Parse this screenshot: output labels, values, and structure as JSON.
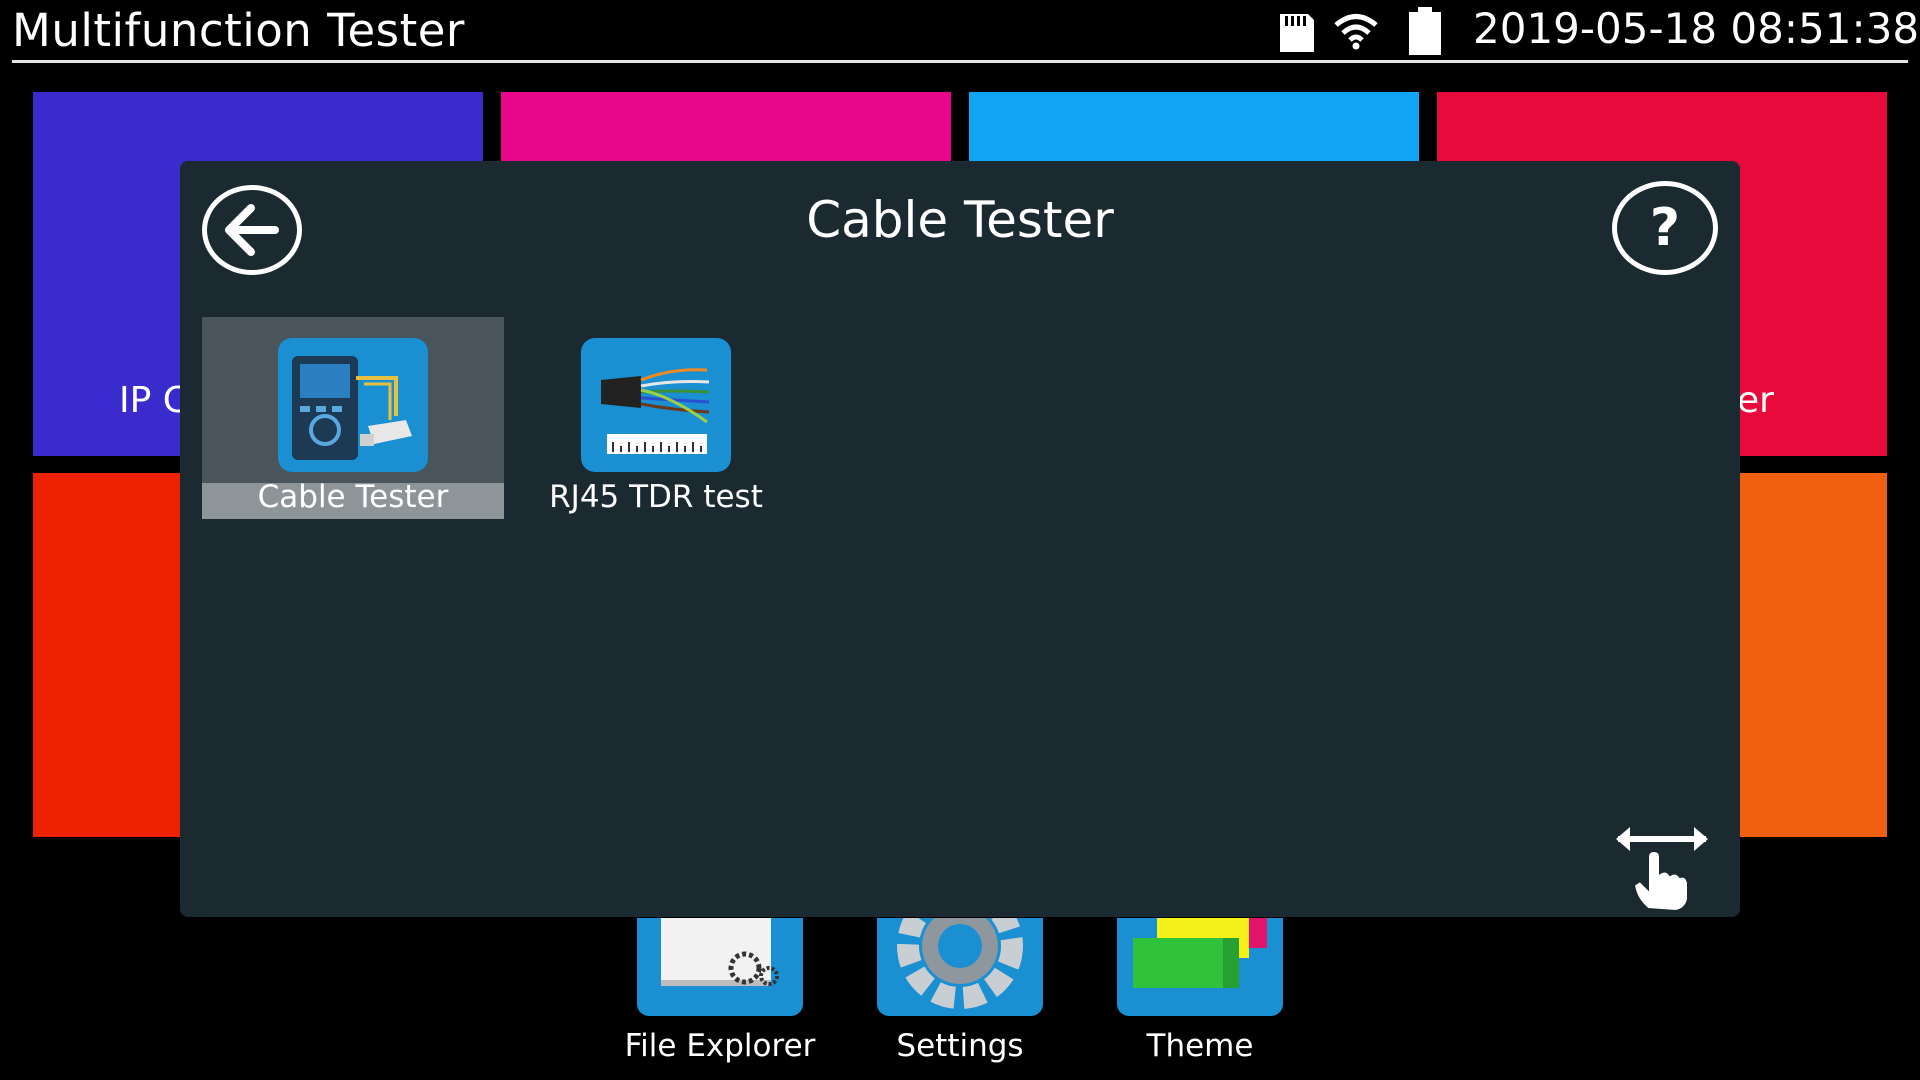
{
  "status_bar": {
    "title": "Multifunction Tester",
    "datetime": "2019-05-18 08:51:38",
    "icons": [
      "sd-card-icon",
      "wifi-icon",
      "battery-icon"
    ]
  },
  "home_tiles": [
    {
      "label": "IP C",
      "color": "#3a2bcc"
    },
    {
      "label": "",
      "color": "#e8078a"
    },
    {
      "label": "",
      "color": "#10a5f5"
    },
    {
      "label": "er",
      "color": "#e80a3a"
    },
    {
      "label": "",
      "color": "#ee2200"
    },
    {
      "label": "",
      "color": "#ee6010"
    }
  ],
  "dock": [
    {
      "label": "File Explorer",
      "icon": "file-explorer-icon"
    },
    {
      "label": "Settings",
      "icon": "settings-gear-icon"
    },
    {
      "label": "Theme",
      "icon": "theme-icon"
    }
  ],
  "dialog": {
    "title": "Cable Tester",
    "help_symbol": "?",
    "items": [
      {
        "label": "Cable Tester",
        "icon": "cable-tester-icon",
        "selected": true
      },
      {
        "label": "RJ45 TDR test",
        "icon": "rj45-tdr-icon",
        "selected": false
      }
    ]
  },
  "colors": {
    "dialog_bg": "#1b2930",
    "selected_bg": "#4a555b",
    "icon_blue": "#1a8fd1"
  }
}
